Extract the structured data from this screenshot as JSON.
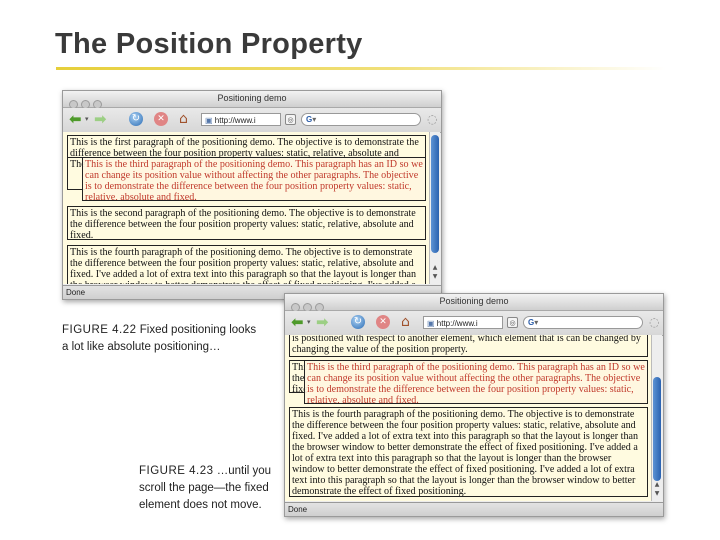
{
  "slide": {
    "title": "The Position Property"
  },
  "browser": {
    "window_title": "Positioning demo",
    "url": "http://www.i",
    "search_glyph": "G",
    "status": "Done"
  },
  "window1": {
    "p1": "This is the first paragraph of the positioning demo. The objective is to demonstrate the difference between the four position property values: static, relative, absolute and fixed.",
    "p1_frag": "The",
    "p3": "This is the third paragraph of the positioning demo. This paragraph has an ID so we can change its position value without affecting the other paragraphs. The objective is to demonstrate the difference between the four position property values: static, relative, absolute and fixed.",
    "p2": "This is the second paragraph of the positioning demo. The objective is to demonstrate the difference between the four position property values: static, relative, absolute and fixed.",
    "p4": "This is the fourth paragraph of the positioning demo. The objective is to demonstrate the difference between the four position property values: static, relative, absolute and fixed. I've added a lot of extra text into this paragraph so that the layout is longer than the browser window to better demonstrate the effect of fixed positioning. I've added a lot of extra text into this paragraph so that the layout is longer than the browser window to better demonstrate the effect of fixed positioning."
  },
  "window2": {
    "p_top": "is positioned with respect to another element, which element that is can be changed by changing the value of the position property.",
    "p_frag": "This the fixe",
    "p3": "This is the third paragraph of the positioning demo. This paragraph has an ID so we can change its position value without affecting the other paragraphs. The objective is to demonstrate the difference between the four position property values: static, relative, absolute and fixed.",
    "p4": "This is the fourth paragraph of the positioning demo. The objective is to demonstrate the difference between the four position property values: static, relative, absolute and fixed. I've added a lot of extra text into this paragraph so that the layout is longer than the browser window to better demonstrate the effect of fixed positioning. I've added a lot of extra text into this paragraph so that the layout is longer than the browser window to better demonstrate the effect of fixed positioning. I've added a lot of extra text into this paragraph so that the layout is longer than the browser window to better demonstrate the effect of fixed positioning."
  },
  "captions": {
    "fig22_label": "FIGURE 4.22",
    "fig22_text_line1": "Fixed positioning looks",
    "fig22_text_line2": "a lot like absolute positioning…",
    "fig23_label": "FIGURE 4.23",
    "fig23_text_line1": "…until you",
    "fig23_text_line2": "scroll the page—the fixed",
    "fig23_text_line3": "element does not move."
  },
  "colors": {
    "accent_rule": "#e6cf3a",
    "page_bg": "#fffbe0",
    "fixed_text": "#c0392b"
  },
  "icons": [
    "back-arrow-icon",
    "forward-arrow-icon",
    "reload-icon",
    "stop-icon",
    "home-icon",
    "page-icon",
    "search-engine-icon"
  ]
}
